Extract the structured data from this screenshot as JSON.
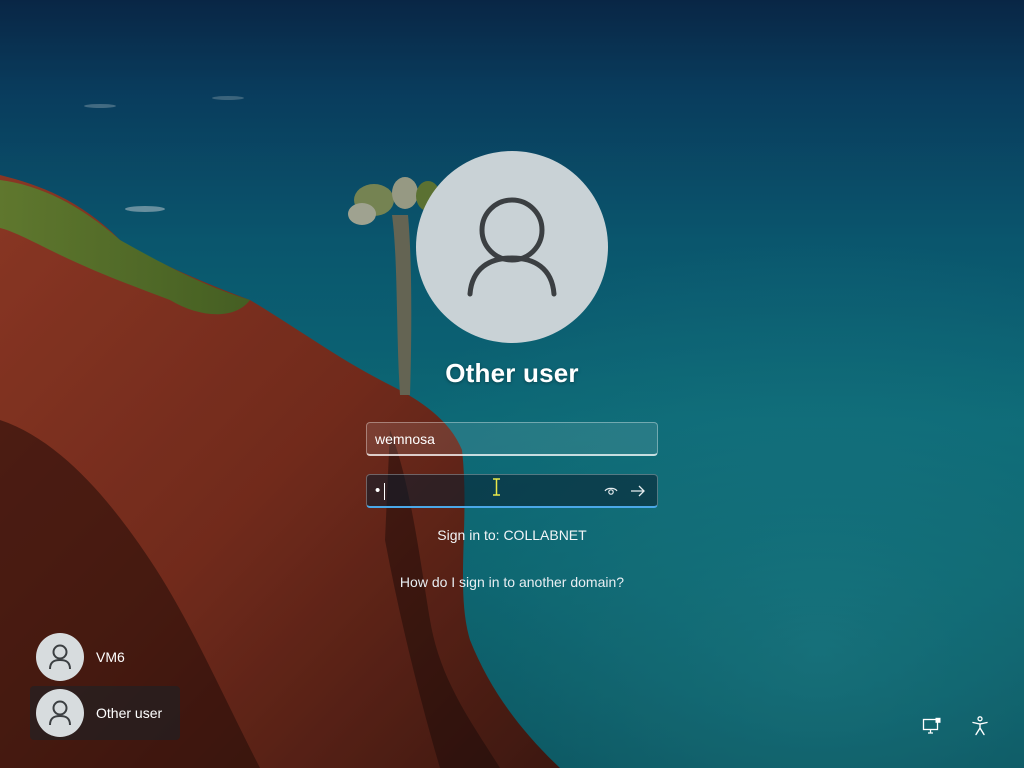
{
  "login": {
    "user_title": "Other user",
    "username_value": "wemnosa",
    "password_value": "•",
    "signin_to": "Sign in to: COLLABNET",
    "help_link": "How do I sign in to another domain?"
  },
  "user_list": [
    {
      "name": "VM6",
      "selected": false
    },
    {
      "name": "Other user",
      "selected": true
    }
  ],
  "icons": {
    "large_avatar": "user-icon",
    "reveal": "eye-icon",
    "submit": "arrow-right-icon",
    "network": "network-icon",
    "accessibility": "accessibility-icon"
  },
  "colors": {
    "focus_accent": "#4aa8e8",
    "avatar_bg": "#c9d2d6"
  }
}
